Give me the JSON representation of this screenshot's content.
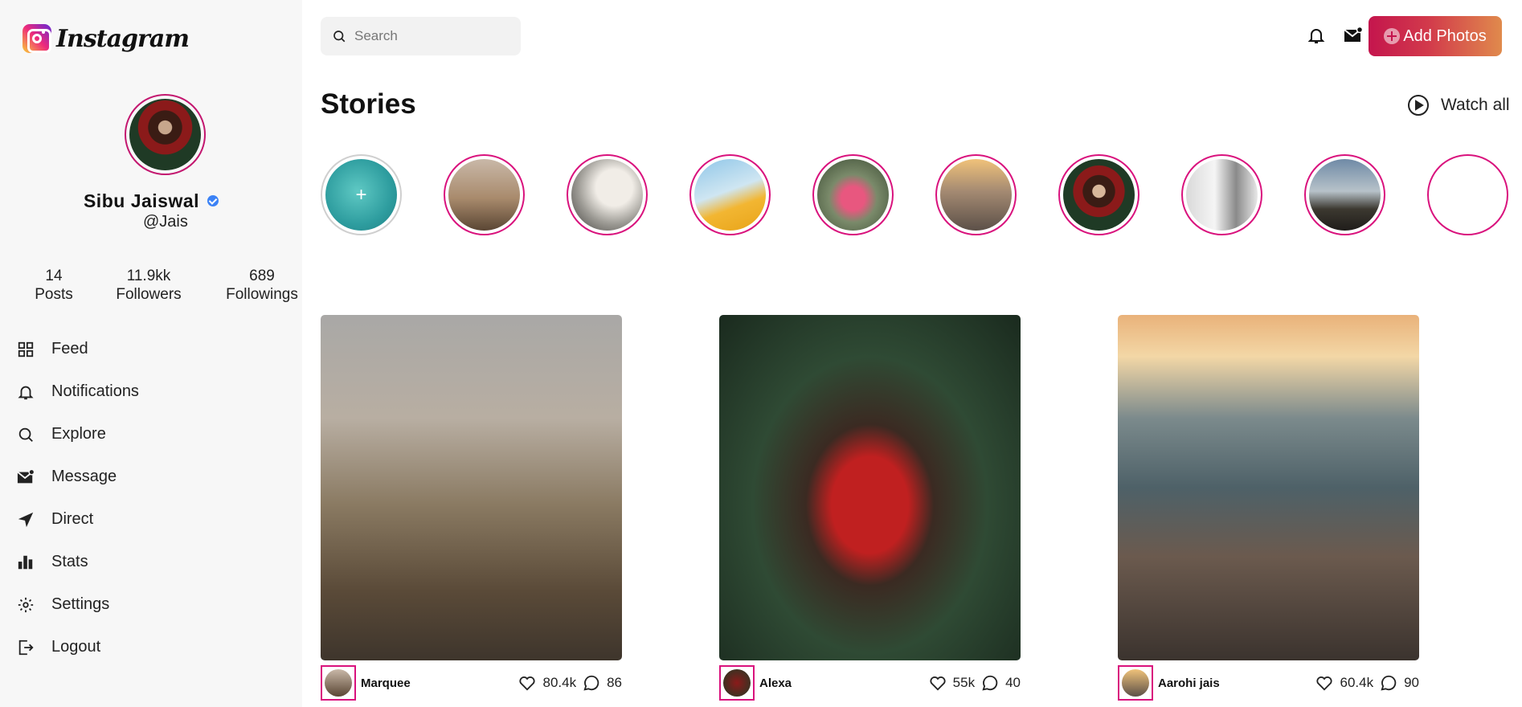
{
  "app": {
    "logo_text": "Instagram"
  },
  "profile": {
    "name": "Sibu Jaiswal",
    "handle": "@Jais",
    "stats": [
      {
        "value": "14",
        "label": "Posts"
      },
      {
        "value": "11.9kk",
        "label": "Followers"
      },
      {
        "value": "689",
        "label": "Followings"
      }
    ]
  },
  "nav": {
    "items": [
      {
        "label": "Feed",
        "icon": "grid-icon"
      },
      {
        "label": "Notifications",
        "icon": "bell-icon"
      },
      {
        "label": "Explore",
        "icon": "search-icon"
      },
      {
        "label": "Message",
        "icon": "mail-icon"
      },
      {
        "label": "Direct",
        "icon": "send-icon"
      },
      {
        "label": "Stats",
        "icon": "bar-chart-icon"
      },
      {
        "label": "Settings",
        "icon": "gear-icon"
      },
      {
        "label": "Logout",
        "icon": "logout-icon"
      }
    ]
  },
  "topbar": {
    "search_placeholder": "Search",
    "add_photos_label": "Add Photos"
  },
  "stories": {
    "title": "Stories",
    "watch_all_label": "Watch all",
    "add_label": "+"
  },
  "posts": [
    {
      "user": "Marquee",
      "likes": "80.4k",
      "comments": "86"
    },
    {
      "user": "Alexa",
      "likes": "55k",
      "comments": "40"
    },
    {
      "user": "Aarohi jais",
      "likes": "60.4k",
      "comments": "90"
    }
  ],
  "colors": {
    "accent": "#d9127d",
    "button_gradient_start": "#c4154d",
    "button_gradient_end": "#e08a4c",
    "verified": "#3b82f6",
    "sidebar_bg": "#f7f7f7"
  }
}
